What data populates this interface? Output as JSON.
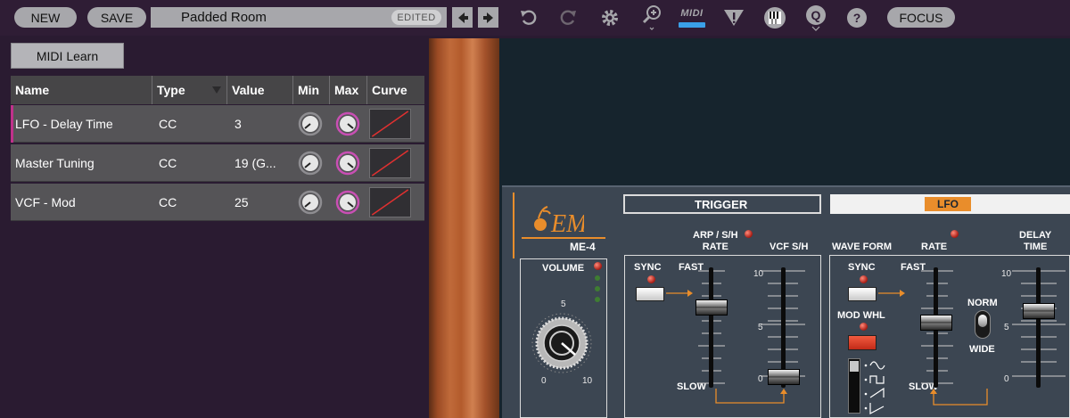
{
  "toolbar": {
    "new_label": "NEW",
    "save_label": "SAVE",
    "preset_name": "Padded Room",
    "edited_badge": "EDITED",
    "midi_label": "MIDI",
    "q_label": "Q",
    "help_label": "?",
    "focus_label": "FOCUS",
    "icons": [
      "arrow-left-icon",
      "arrow-right-icon",
      "undo-icon",
      "redo-icon",
      "settings-gear-icon",
      "zoom-icon",
      "midi-icon",
      "warning-triangle-icon",
      "keyboard-icon",
      "q-icon",
      "help-icon"
    ],
    "accent_color": "#3aa0e8"
  },
  "midi_panel": {
    "learn_button": "MIDI Learn",
    "columns": [
      "Name",
      "Type",
      "Value",
      "Min",
      "Max",
      "Curve"
    ],
    "rows": [
      {
        "name": "LFO - Delay Time",
        "type": "CC",
        "value": "3"
      },
      {
        "name": "Master Tuning",
        "type": "CC",
        "value": "19 (G..."
      },
      {
        "name": "VCF - Mod",
        "type": "CC",
        "value": "25"
      }
    ],
    "selected_row_color": "#c0318b",
    "max_knob_color": "#c94fb4",
    "curve_color": "#e03030"
  },
  "synth": {
    "model": "ME-4",
    "volume": {
      "label": "VOLUME",
      "scale_min": "0",
      "scale_mid": "5",
      "scale_max": "10"
    },
    "trigger": {
      "header": "TRIGGER",
      "arp_rate_label": "ARP / S/H\nRATE",
      "vcf_sh_label": "VCF S/H",
      "sync_label": "SYNC",
      "fast_label": "FAST",
      "slow_label": "SLOW",
      "scale_10": "10",
      "scale_5": "5",
      "scale_0": "0"
    },
    "lfo": {
      "header": "LFO",
      "wave_form_label": "WAVE FORM",
      "rate_label": "RATE",
      "delay_time_label": "DELAY\nTIME",
      "sync_label": "SYNC",
      "fast_label": "FAST",
      "mod_whl_label": "MOD WHL",
      "norm_label": "NORM",
      "wide_label": "WIDE",
      "slow_label": "SLOW",
      "scale_10": "10",
      "scale_5": "5",
      "scale_0": "0"
    },
    "header_accent": "#e98d2b",
    "led_color": "#d8261a"
  }
}
